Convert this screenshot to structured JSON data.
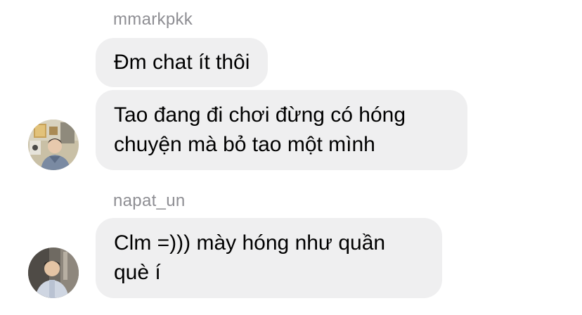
{
  "messages": [
    {
      "sender": "mmarkpkk",
      "bubbles": [
        "Đm chat ít thôi",
        "Tao đang đi chơi đừng có hóng\nchuyện mà bỏ tao một mình"
      ]
    },
    {
      "sender": "napat_un",
      "bubbles": [
        "Clm =))) mày hóng như quần\nquè í"
      ]
    }
  ]
}
